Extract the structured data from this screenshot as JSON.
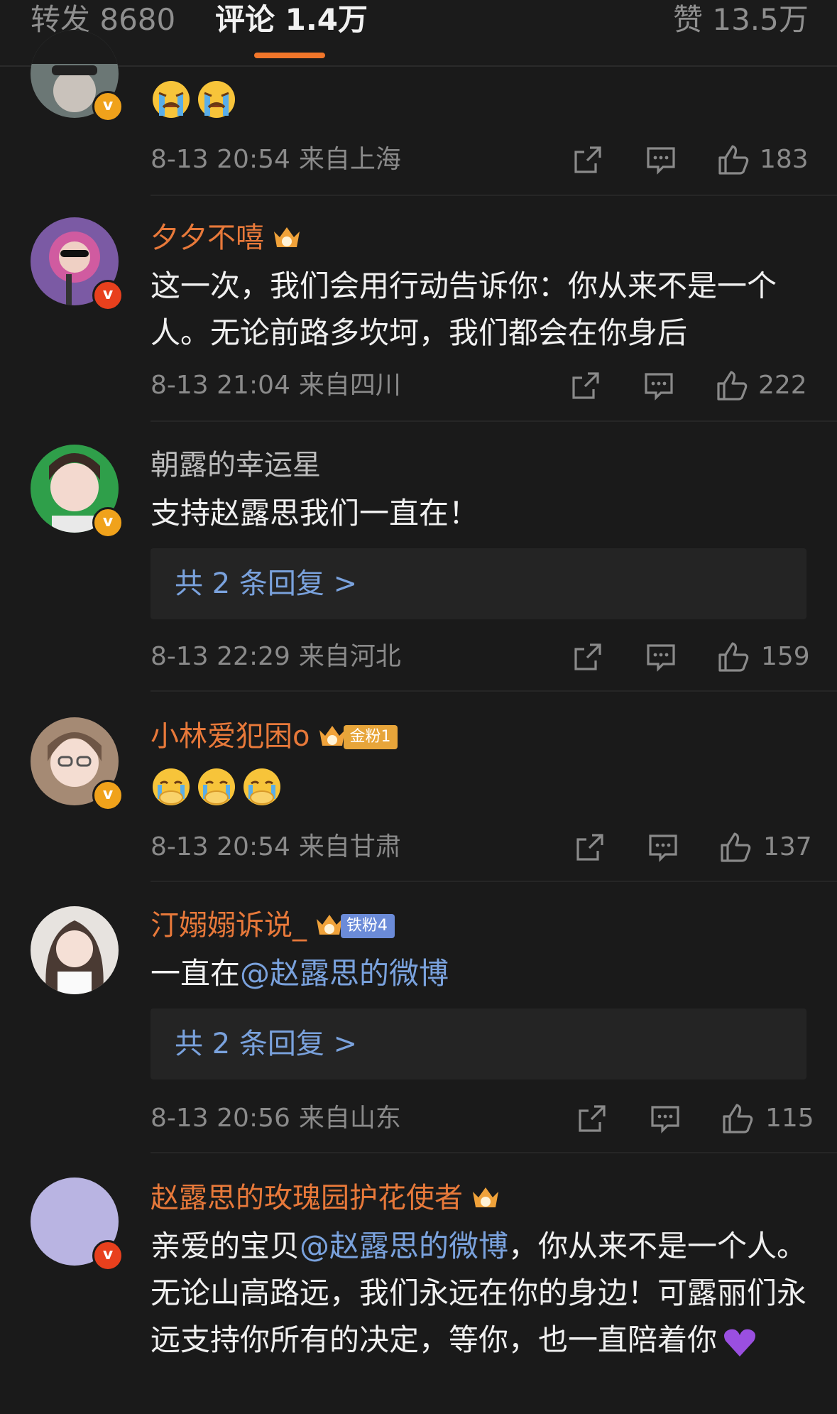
{
  "tabs": {
    "repost": "转发 8680",
    "comments": "评论 1.4万",
    "likes": "赞 13.5万"
  },
  "comments": [
    {
      "name": "",
      "text": "",
      "emoji_count": 2,
      "emoji": "crying-face",
      "time": "8-13 20:54",
      "location": "来自上海",
      "likes": "183"
    },
    {
      "name": "夕夕不嘻",
      "text": "这一次，我们会用行动告诉你：你从来不是一个人。无论前路多坎坷，我们都会在你身后",
      "time": "8-13 21:04",
      "location": "来自四川",
      "likes": "222"
    },
    {
      "name": "朝露的幸运星",
      "text": "支持赵露思我们一直在！",
      "replies": "共 2 条回复 >",
      "time": "8-13 22:29",
      "location": "来自河北",
      "likes": "159"
    },
    {
      "name": "小林爱犯困o",
      "fan_badge": "金粉1",
      "emoji_count": 3,
      "emoji": "crying-cover-face",
      "time": "8-13 20:54",
      "location": "来自甘肃",
      "likes": "137"
    },
    {
      "name": "汀嫋嫋诉说_",
      "fan_badge": "铁粉4",
      "text_prefix": "一直在",
      "mention": "@赵露思的微博",
      "replies": "共 2 条回复 >",
      "time": "8-13 20:56",
      "location": "来自山东",
      "likes": "115"
    },
    {
      "name": "赵露思的玫瑰园护花使者",
      "text_prefix": "亲爱的宝贝",
      "mention": "@赵露思的微博",
      "text_suffix": "，你从来不是一个人。无论山高路远，我们永远在你的身边！可露丽们永远支持你所有的决定，等你，也一直陪着你",
      "emoji": "purple-heart"
    }
  ],
  "colors": {
    "background": "#1a1a1a",
    "accent": "#f2762a",
    "username": "#e8793a",
    "mention": "#7aa2dd",
    "meta": "#8a8a8a"
  },
  "icons": [
    "share-icon",
    "comment-icon",
    "thumbs-up-icon",
    "verified-badge-icon",
    "crown-icon"
  ]
}
